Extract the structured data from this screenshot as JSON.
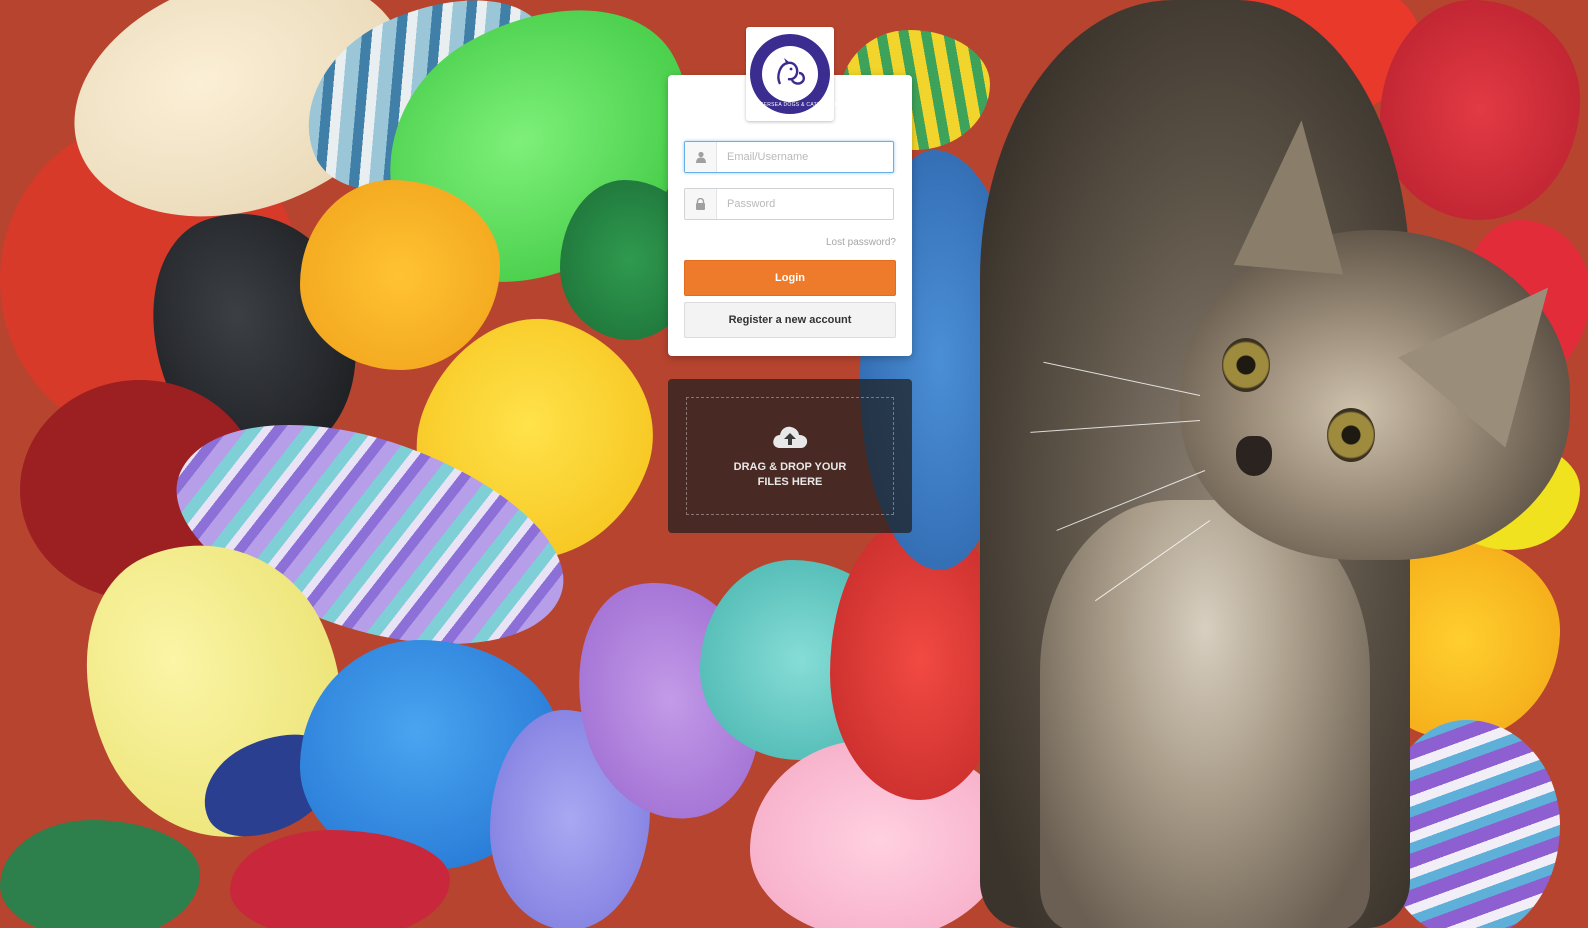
{
  "background": {
    "description_icon": "knitted-toys-and-kitten-photo"
  },
  "logo": {
    "icon": "dog-and-cat-logo-icon",
    "ring_text": "BATTERSEA DOGS & CATS HOME",
    "color": "#3b2c8f"
  },
  "login": {
    "username": {
      "icon": "user-icon",
      "placeholder": "Email/Username",
      "value": ""
    },
    "password": {
      "icon": "lock-icon",
      "placeholder": "Password",
      "value": ""
    },
    "lost_password_label": "Lost password?",
    "login_label": "Login",
    "register_label": "Register a new account",
    "accent_color": "#ee7b2c"
  },
  "dropzone": {
    "icon": "cloud-upload-icon",
    "label": "DRAG & DROP YOUR FILES HERE"
  }
}
